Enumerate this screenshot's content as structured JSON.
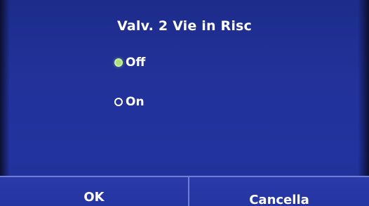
{
  "dialog": {
    "title": "Valv. 2 Vie in Risc",
    "options": [
      {
        "label": "Off",
        "selected": true
      },
      {
        "label": "On",
        "selected": false
      }
    ],
    "buttons": {
      "ok_label": "OK",
      "cancel_label": "Cancella"
    }
  },
  "colors": {
    "background": "#22329a",
    "radio_selected": "#a9e07d",
    "text": "#ffffff",
    "divider": "#6f7fd8"
  }
}
